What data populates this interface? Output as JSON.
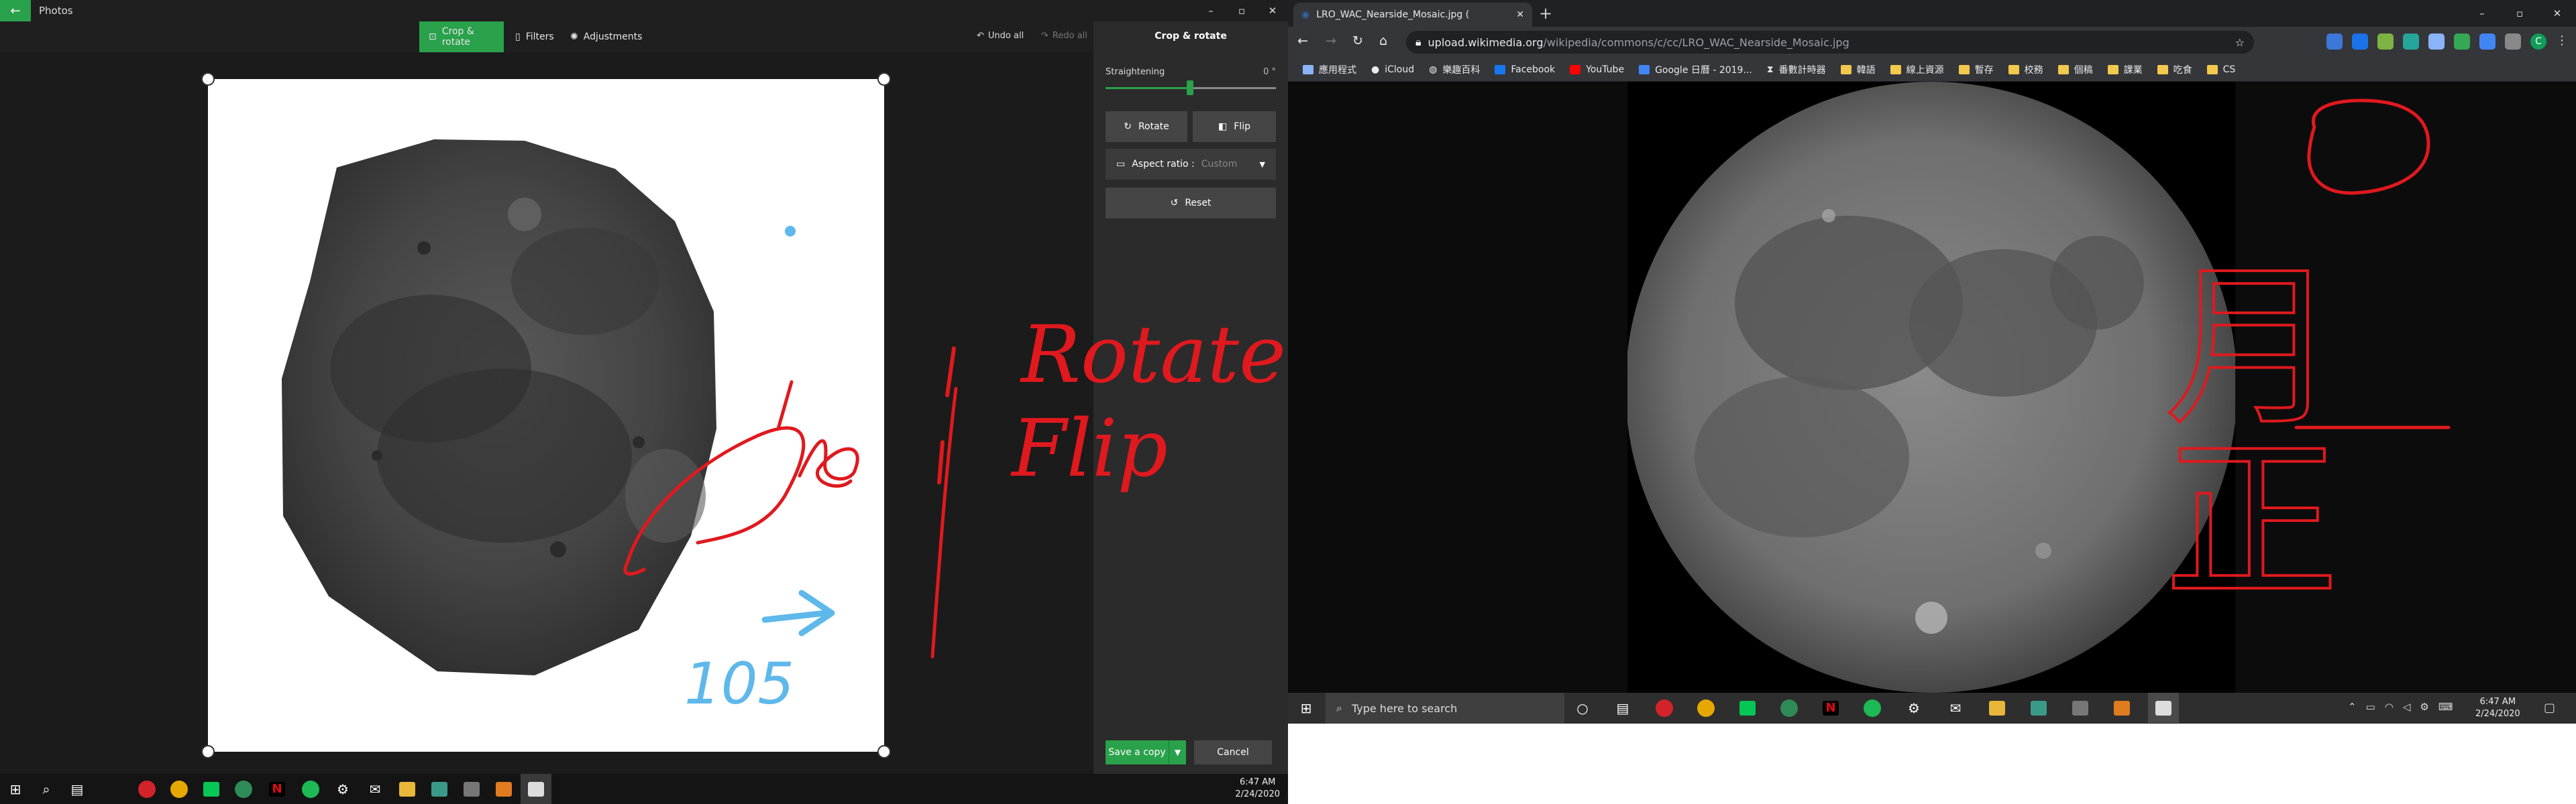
{
  "photos": {
    "window_title": "Photos",
    "toolbar": {
      "tabs": [
        {
          "label": "Crop & rotate",
          "icon": "crop-icon",
          "active": true
        },
        {
          "label": "Filters",
          "icon": "filters-icon"
        },
        {
          "label": "Adjustments",
          "icon": "adjustments-icon"
        }
      ],
      "undo_all": "Undo all",
      "redo_all": "Redo all"
    },
    "panel": {
      "title": "Crop & rotate",
      "straightening_label": "Straightening",
      "straightening_value": "0 °",
      "straightening_level": 0.5,
      "rotate_label": "Rotate",
      "flip_label": "Flip",
      "aspect_label": "Aspect ratio :",
      "aspect_value": "Custom",
      "reset_label": "Reset"
    },
    "save_label": "Save a copy",
    "cancel_label": "Cancel",
    "annotations": {
      "handwriting_rotate": "Rotate",
      "handwriting_flip": "Flip",
      "handwriting_blue": "105"
    }
  },
  "left_taskbar": {
    "time": "6:47 AM",
    "date": "2/24/2020"
  },
  "chrome": {
    "tab_title": "LRO_WAC_Nearside_Mosaic.jpg (",
    "url_host": "upload.wikimedia.org",
    "url_path": "/wikipedia/commons/c/cc/LRO_WAC_Nearside_Mosaic.jpg",
    "bookmarks": [
      {
        "label": "應用程式",
        "icon": "apps-icon"
      },
      {
        "label": "iCloud",
        "icon": "apple-icon"
      },
      {
        "label": "樂趣百科",
        "icon": "globe-icon"
      },
      {
        "label": "Facebook",
        "icon": "facebook-icon"
      },
      {
        "label": "YouTube",
        "icon": "youtube-icon"
      },
      {
        "label": "Google 日曆 - 2019...",
        "icon": "calendar-icon"
      },
      {
        "label": "番數計時器",
        "icon": "hourglass-icon"
      },
      {
        "label": "韓語",
        "icon": "folder-icon"
      },
      {
        "label": "線上資源",
        "icon": "folder-icon"
      },
      {
        "label": "暫存",
        "icon": "folder-icon"
      },
      {
        "label": "校務",
        "icon": "folder-icon"
      },
      {
        "label": "個稿",
        "icon": "folder-icon"
      },
      {
        "label": "課業",
        "icon": "folder-icon"
      },
      {
        "label": "吃食",
        "icon": "folder-icon"
      },
      {
        "label": "CS",
        "icon": "folder-icon"
      }
    ],
    "annotations": {
      "handwriting_cjk": "月正"
    }
  },
  "right_taskbar": {
    "search_placeholder": "Type here to search",
    "time": "6:47 AM",
    "date": "2/24/2020"
  },
  "colors": {
    "accent_green": "#2aa14b",
    "ink_red": "#e0191e",
    "ink_blue": "#5fb8ea"
  }
}
